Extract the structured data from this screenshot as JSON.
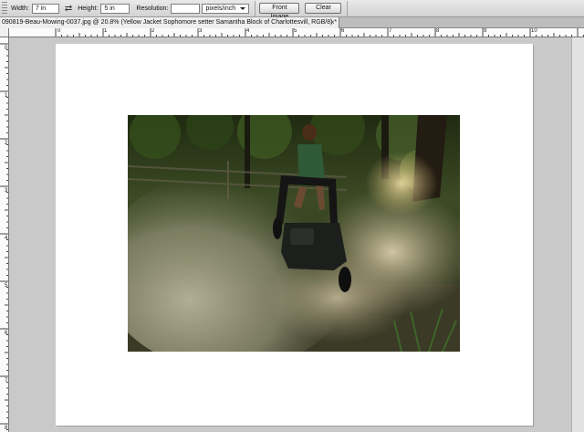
{
  "options_bar": {
    "width_label": "Width:",
    "width_value": "7 in",
    "height_label": "Height:",
    "height_value": "5 in",
    "resolution_label": "Resolution:",
    "resolution_value": "",
    "unit_select": "pixels/inch",
    "front_image_button": "Front Image",
    "clear_button": "Clear"
  },
  "document": {
    "tab_title": "090819-Beau-Mowing-0037.jpg @ 20.8% (Yellow Jacket Sophomore setter Samantha Block of Charlottesvill, RGB/8) *",
    "close_glyph": "×"
  },
  "rulers": {
    "top_numbers": [
      "0",
      "1",
      "2",
      "3",
      "4",
      "5",
      "6",
      "7",
      "8",
      "9",
      "10"
    ],
    "left_numbers": [
      "0",
      "1",
      "2",
      "3",
      "4",
      "5",
      "6",
      "7",
      "8"
    ]
  },
  "icons": {
    "swap": "swap-arrows-icon",
    "dropdown": "chevron-down-icon",
    "grip": "toolbar-grip-icon"
  },
  "colors": {
    "workspace": "#c9c9c9",
    "canvas": "#ffffff",
    "toolbar": "#dcdcdc"
  }
}
